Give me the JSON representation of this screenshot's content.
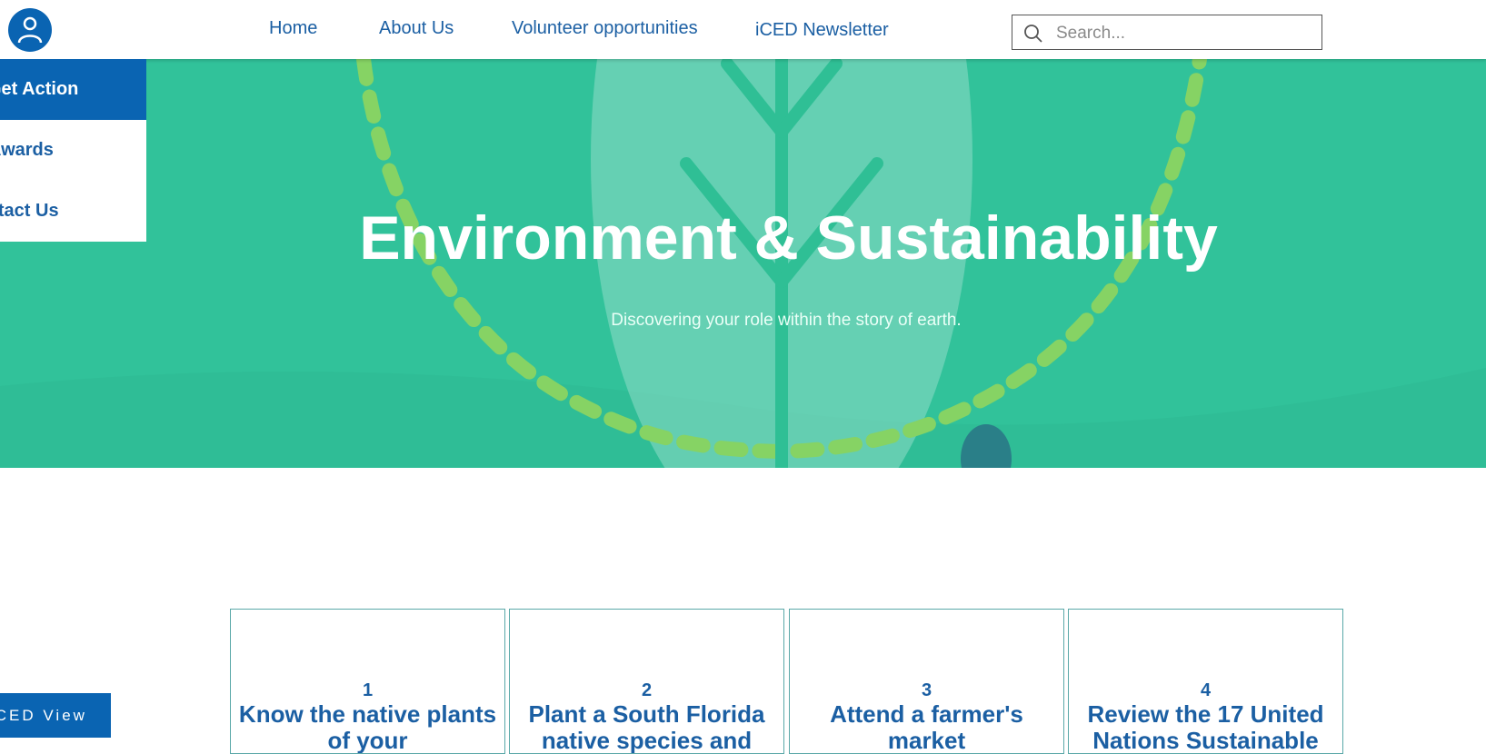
{
  "header": {
    "nav": [
      "Home",
      "About Us",
      "Volunteer opportunities",
      "iCED Newsletter"
    ],
    "search_placeholder": "Search..."
  },
  "sidemenu": {
    "items": [
      "Get Action",
      "Awards",
      "Contact Us"
    ]
  },
  "hero": {
    "title": "Environment & Sustainability",
    "subtitle": "Discovering your role within the story of earth."
  },
  "cards": [
    {
      "num": "1",
      "title": "Know the native plants of your"
    },
    {
      "num": "2",
      "title": "Plant a South Florida native species and"
    },
    {
      "num": "3",
      "title": "Attend a farmer's market"
    },
    {
      "num": "4",
      "title": "Review the 17 United Nations Sustainable"
    }
  ],
  "view_button": "iCED View",
  "colors": {
    "brand": "#0a64b2",
    "hero": "#31c29a",
    "link": "#1b5fa3"
  }
}
